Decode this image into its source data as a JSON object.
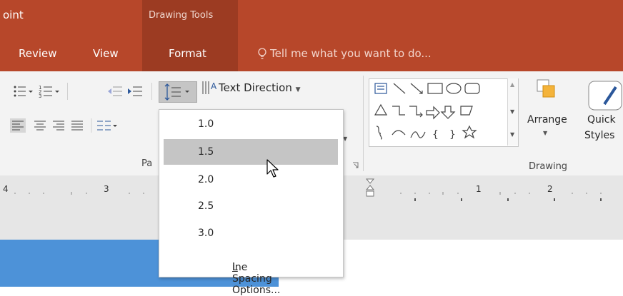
{
  "app": {
    "title_fragment": "oint",
    "context_group": "Drawing Tools"
  },
  "tabs": [
    {
      "label": "Review"
    },
    {
      "label": "View"
    },
    {
      "label": "Format"
    }
  ],
  "tell_me": {
    "text": "Tell me what you want to do..."
  },
  "ribbon": {
    "text_direction_label": "Text Direction",
    "paragraph_label_fragment": "Pa",
    "drawing_label": "Drawing",
    "arrange_label": "Arrange",
    "quick_label": "Quick",
    "styles_label": "Styles"
  },
  "ruler": {
    "labels": [
      "4",
      "3",
      "1",
      "2"
    ]
  },
  "line_spacing_menu": {
    "options": [
      "1.0",
      "1.5",
      "2.0",
      "2.5",
      "3.0"
    ],
    "selected": "1.5",
    "more_options_prefix": "L",
    "more_options_rest": "ine Spacing Options..."
  },
  "colors": {
    "accent": "#b7472a",
    "context_group": "#9c3b22",
    "selection": "#c5c5c5"
  }
}
